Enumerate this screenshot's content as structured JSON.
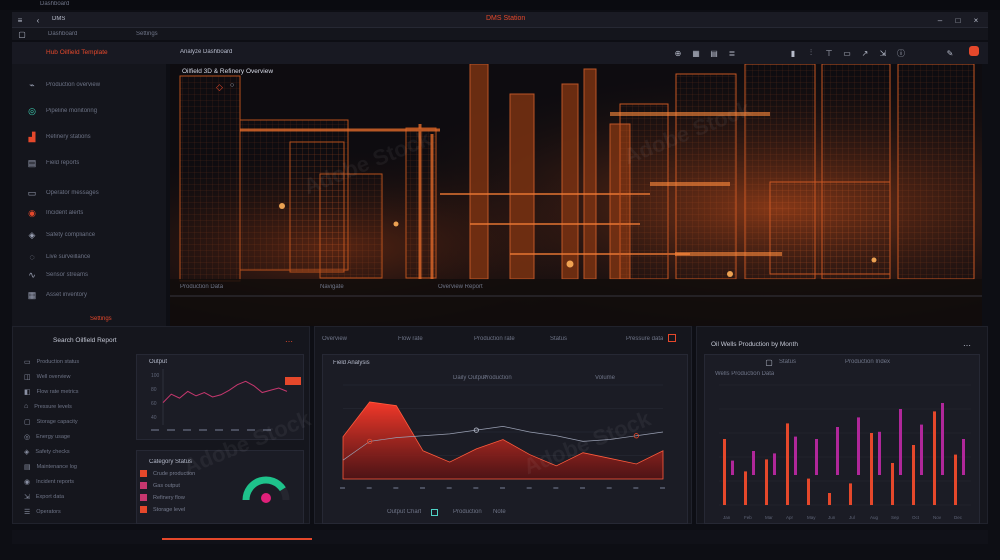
{
  "app": {
    "top_left_label": "Dashboard",
    "top_small_label": "DMS",
    "title": "DMS Station",
    "breadcrumb_1": "Dashboard",
    "breadcrumb_2": "Settings",
    "brand_text": "Hub Oilfield Template",
    "main_tab": "Analyze Dashboard",
    "accent_color": "#e5482b",
    "bg_color": "#0d0e14"
  },
  "viewport": {
    "title": "Oilfield 3D & Refinery Overview",
    "footer_labels": [
      "Production Data",
      "Navigate",
      "Overview Report"
    ]
  },
  "sidebar": {
    "items": [
      {
        "icon": "chart-line-icon",
        "label": "Production overview"
      },
      {
        "icon": "target-icon",
        "label": "Pipeline monitoring"
      },
      {
        "icon": "factory-icon",
        "label": "Refinery stations"
      },
      {
        "icon": "document-icon",
        "label": "Field reports"
      },
      {
        "icon": "chat-icon",
        "label": "Operator messages"
      },
      {
        "icon": "alert-icon",
        "label": "Incident alerts"
      },
      {
        "icon": "shield-icon",
        "label": "Safety compliance"
      },
      {
        "icon": "eye-icon",
        "label": "Live surveillance"
      },
      {
        "icon": "wave-icon",
        "label": "Sensor streams"
      },
      {
        "icon": "grid-icon",
        "label": "Asset inventory"
      }
    ],
    "footer": "Settings"
  },
  "left_panel": {
    "title": "Search Oilfield Report",
    "lines": [
      "Production status",
      "Well overview",
      "Flow rate metrics",
      "Pressure levels",
      "Storage capacity",
      "Energy usage",
      "Safety checks",
      "Maintenance log",
      "Incident reports",
      "Export data",
      "Operators"
    ],
    "mini_chart_title": "Output",
    "mini_chart_axis": [
      "100",
      "80",
      "60",
      "40"
    ],
    "list_title": "Category Status",
    "list_items": [
      "Crude production",
      "Gas output",
      "Refinery flow",
      "Storage level"
    ]
  },
  "center_panel": {
    "tabs": [
      "Overview",
      "Flow rate",
      "Production rate",
      "Status",
      "Pressure data"
    ],
    "chart_title": "Field Analysis",
    "sub_labels": [
      "Daily Output",
      "Production",
      "Volume"
    ],
    "footer_labels": [
      "Output Chart",
      "Production",
      "Note"
    ]
  },
  "right_panel": {
    "title": "Oil Wells Production by Month",
    "legend_1": "Status",
    "legend_2": "Production Index",
    "sub_label": "Wells Production Data",
    "axis": [
      "Jan",
      "Feb",
      "Mar",
      "Apr",
      "May",
      "Jun",
      "Jul",
      "Aug",
      "Sep",
      "Oct",
      "Nov",
      "Dec"
    ]
  },
  "chart_data": [
    {
      "type": "line",
      "title": "",
      "x": [
        1,
        2,
        3,
        4,
        5,
        6,
        7,
        8,
        9,
        10,
        11,
        12,
        13,
        14,
        15,
        16
      ],
      "values": [
        40,
        55,
        48,
        60,
        52,
        58,
        50,
        54,
        62,
        72,
        78,
        70,
        58,
        62,
        66,
        60
      ],
      "ylim": [
        0,
        100
      ]
    },
    {
      "type": "area",
      "title": "",
      "x": [
        0,
        1,
        2,
        3,
        4,
        5,
        6,
        7,
        8,
        9,
        10,
        11,
        12
      ],
      "values": [
        45,
        82,
        78,
        30,
        18,
        32,
        42,
        26,
        14,
        28,
        22,
        16,
        30
      ],
      "line": [
        20,
        40,
        44,
        46,
        48,
        52,
        56,
        50,
        46,
        40,
        42,
        46,
        50
      ],
      "ylim": [
        0,
        100
      ]
    },
    {
      "type": "bar",
      "title": "",
      "series": [
        {
          "name": "",
          "color": "#e5482b",
          "values": [
            55,
            28,
            38,
            68,
            22,
            10,
            18,
            60,
            35,
            50,
            78,
            42
          ]
        },
        {
          "name": "",
          "color": "#b0279a",
          "values": [
            12,
            20,
            18,
            32,
            30,
            40,
            48,
            36,
            55,
            42,
            60,
            30
          ]
        }
      ],
      "ylim": [
        0,
        100
      ]
    },
    {
      "type": "pie",
      "title": "",
      "values": [
        82,
        18
      ],
      "colors": [
        "#1ec28b",
        "#25262f"
      ]
    }
  ]
}
